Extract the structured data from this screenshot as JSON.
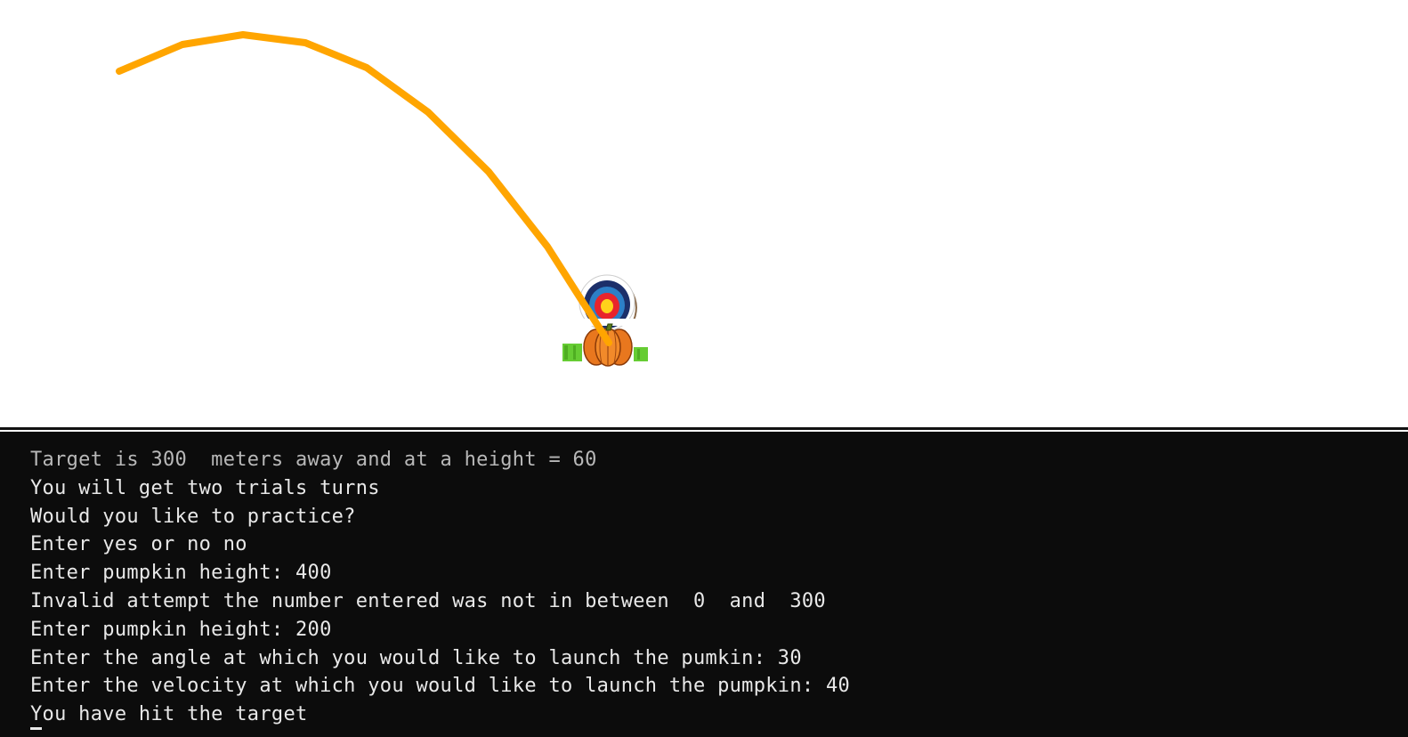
{
  "scene": {
    "trajectory_color": "#FFA500",
    "target_icon": "archery-target-icon",
    "pumpkin_icon": "pumpkin-icon",
    "grass_color": "#66cc33"
  },
  "console": {
    "background": "#0c0c0c",
    "lines": [
      "Target is 300  meters away and at a height = 60",
      "You will get two trials turns",
      "Would you like to practice?",
      "Enter yes or no no",
      "Enter pumpkin height: 400",
      "Invalid attempt the number entered was not in between  0  and  300",
      "Enter pumpkin height: 200",
      "Enter the angle at which you would like to launch the pumkin: 30",
      "Enter the velocity at which you would like to launch the pumpkin: 40",
      "You have hit the target"
    ]
  }
}
